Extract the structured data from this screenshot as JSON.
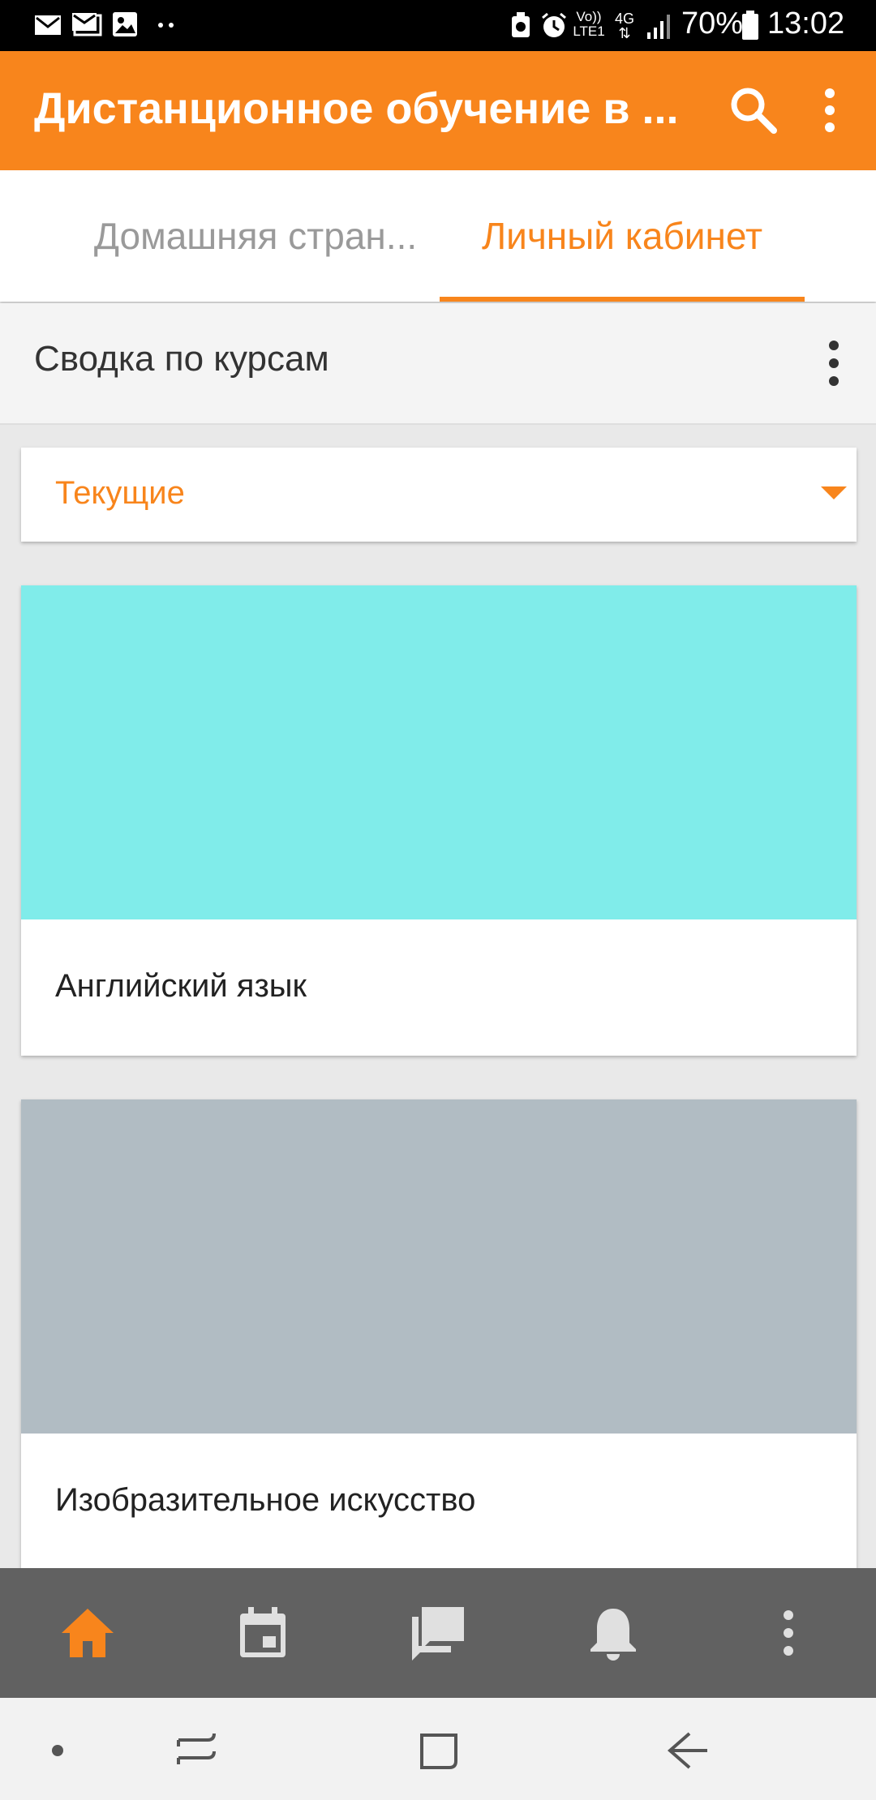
{
  "status_bar": {
    "battery": "70%",
    "time": "13:02",
    "network_volte": "Vo))",
    "network_lte": "LTE1",
    "network_4g": "4G"
  },
  "app_bar": {
    "title": "Дистанционное обучение в ...",
    "search_icon": "search-icon",
    "menu_icon": "more-vert-icon"
  },
  "tabs": [
    {
      "label": "Домашняя стран...",
      "active": false
    },
    {
      "label": "Личный кабинет",
      "active": true
    }
  ],
  "section": {
    "title": "Сводка по курсам",
    "menu_icon": "more-vert-icon"
  },
  "filter": {
    "selected": "Текущие",
    "icon": "caret-down-icon"
  },
  "courses": [
    {
      "title": "Английский язык",
      "color": "#80ecea"
    },
    {
      "title": "Изобразительное искусство",
      "color": "#b1bcc3"
    }
  ],
  "bottom_nav": [
    {
      "icon": "home-icon",
      "active": true
    },
    {
      "icon": "calendar-icon",
      "active": false
    },
    {
      "icon": "messages-icon",
      "active": false
    },
    {
      "icon": "bell-icon",
      "active": false
    },
    {
      "icon": "more-vert-icon",
      "active": false
    }
  ],
  "colors": {
    "accent": "#f8851c",
    "bottom_nav_bg": "#616161",
    "inactive_icon": "#e0e0e0"
  }
}
